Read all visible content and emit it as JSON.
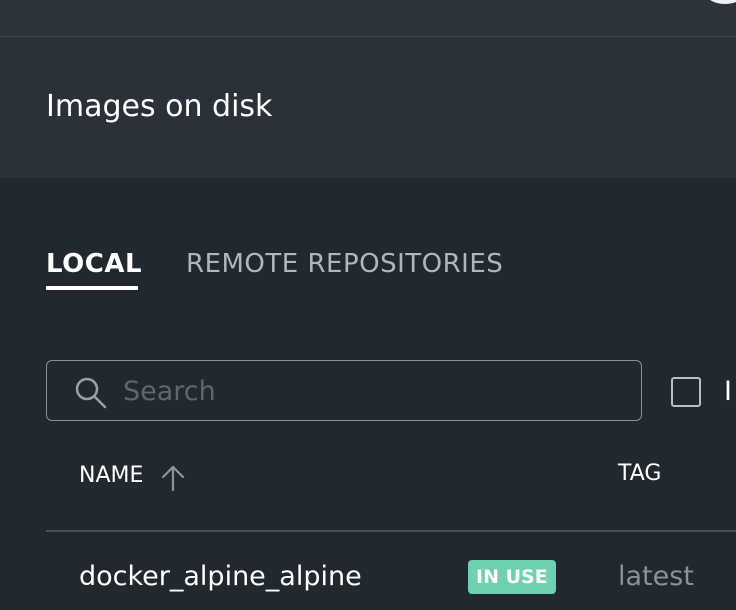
{
  "header": {
    "title": "Images on disk"
  },
  "tabs": {
    "local": "LOCAL",
    "remote": "REMOTE REPOSITORIES"
  },
  "search": {
    "placeholder": "Search",
    "value": ""
  },
  "filter_checkbox": {
    "label": "I",
    "checked": false
  },
  "table": {
    "columns": {
      "name": "NAME",
      "tag": "TAG"
    },
    "sort": "name-ascending",
    "rows": [
      {
        "name": "docker_alpine_alpine",
        "badge": "IN USE",
        "tag": "latest"
      }
    ]
  },
  "colors": {
    "badge": "#6fd0b0",
    "background": "#222830",
    "header_background": "#2b3139"
  },
  "icons": [
    "search-icon",
    "arrow-up-icon",
    "checkbox-icon"
  ]
}
